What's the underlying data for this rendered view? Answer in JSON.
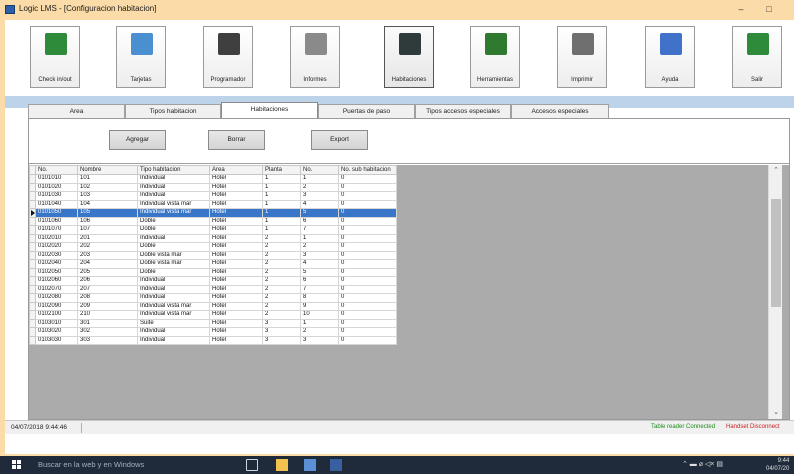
{
  "window": {
    "title": "Logic LMS - [Configuracion habitacion]",
    "minimize_glyph": "–",
    "maximize_glyph": "□"
  },
  "toolbar": [
    {
      "label": "Check in/out",
      "icon": "monitor-icon",
      "color": "#2e8b3a"
    },
    {
      "label": "Tarjetas",
      "icon": "cards-icon",
      "color": "#4a8fcf"
    },
    {
      "label": "Programador",
      "icon": "programmer-icon",
      "color": "#3f3f3f"
    },
    {
      "label": "Informes",
      "icon": "reports-icon",
      "color": "#8a8a8a"
    },
    {
      "label": "Habitaciones",
      "icon": "door-icon",
      "color": "#2f3a3a"
    },
    {
      "label": "Herramientas",
      "icon": "tools-icon",
      "color": "#2f7a2f"
    },
    {
      "label": "Imprimir",
      "icon": "printer-icon",
      "color": "#6f6f6f"
    },
    {
      "label": "Ayuda",
      "icon": "help-book-icon",
      "color": "#3f72c8"
    },
    {
      "label": "Salir",
      "icon": "exit-icon",
      "color": "#2e8b3a"
    }
  ],
  "tabs": [
    {
      "label": "Area",
      "active": false
    },
    {
      "label": "Tipos habitacion",
      "active": false
    },
    {
      "label": "Habitaciones",
      "active": true
    },
    {
      "label": "Puertas de paso",
      "active": false
    },
    {
      "label": "Tipos accesos especiales",
      "active": false
    },
    {
      "label": "Accesos especiales",
      "active": false
    }
  ],
  "actions": {
    "add": "Agregar",
    "delete": "Borrar",
    "export": "Export"
  },
  "table": {
    "columns": [
      "No.",
      "Nombre",
      "Tipo habitacion",
      "Area",
      "Planta",
      "No.",
      "No. sub habitacion"
    ],
    "selected_index": 4,
    "rows": [
      [
        "0101010",
        "101",
        "Individual",
        "Hotel",
        "1",
        "1",
        "0"
      ],
      [
        "0101020",
        "102",
        "Individual",
        "Hotel",
        "1",
        "2",
        "0"
      ],
      [
        "0101030",
        "103",
        "Individual",
        "Hotel",
        "1",
        "3",
        "0"
      ],
      [
        "0101040",
        "104",
        "Individual vista mar",
        "Hotel",
        "1",
        "4",
        "0"
      ],
      [
        "0101050",
        "105",
        "Individual vista mar",
        "Hotel",
        "1",
        "5",
        "0"
      ],
      [
        "0101060",
        "106",
        "Doble",
        "Hotel",
        "1",
        "6",
        "0"
      ],
      [
        "0101070",
        "107",
        "Doble",
        "Hotel",
        "1",
        "7",
        "0"
      ],
      [
        "0102010",
        "201",
        "Individual",
        "Hotel",
        "2",
        "1",
        "0"
      ],
      [
        "0102020",
        "202",
        "Doble",
        "Hotel",
        "2",
        "2",
        "0"
      ],
      [
        "0102030",
        "203",
        "Doble vista mar",
        "Hotel",
        "2",
        "3",
        "0"
      ],
      [
        "0102040",
        "204",
        "Doble vista mar",
        "Hotel",
        "2",
        "4",
        "0"
      ],
      [
        "0102050",
        "205",
        "Doble",
        "Hotel",
        "2",
        "5",
        "0"
      ],
      [
        "0102060",
        "206",
        "Individual",
        "Hotel",
        "2",
        "6",
        "0"
      ],
      [
        "0102070",
        "207",
        "Individual",
        "Hotel",
        "2",
        "7",
        "0"
      ],
      [
        "0102080",
        "208",
        "Individual",
        "Hotel",
        "2",
        "8",
        "0"
      ],
      [
        "0102090",
        "209",
        "Individual vista mar",
        "Hotel",
        "2",
        "9",
        "0"
      ],
      [
        "0102100",
        "210",
        "Individual vista mar",
        "Hotel",
        "2",
        "10",
        "0"
      ],
      [
        "0103010",
        "301",
        "Suite",
        "Hotel",
        "3",
        "1",
        "0"
      ],
      [
        "0103020",
        "302",
        "Individual",
        "Hotel",
        "3",
        "2",
        "0"
      ],
      [
        "0103030",
        "303",
        "Individual",
        "Hotel",
        "3",
        "3",
        "0"
      ]
    ]
  },
  "status": {
    "datetime": "04/07/2018 9:44:46",
    "reader": "Table reader Connected",
    "handset": "Handset Disconnect"
  },
  "taskbar": {
    "search_placeholder": "Buscar en la web y en Windows",
    "tray_glyphs": "⌃ ▬ ⌀ ◁× ▤",
    "time": "9:44",
    "date": "04/07/20"
  },
  "colors": {
    "selection": "#3a76c8",
    "status_ok": "#1a8a1a",
    "status_error": "#c81e1e",
    "band": "#bcd3ea"
  }
}
